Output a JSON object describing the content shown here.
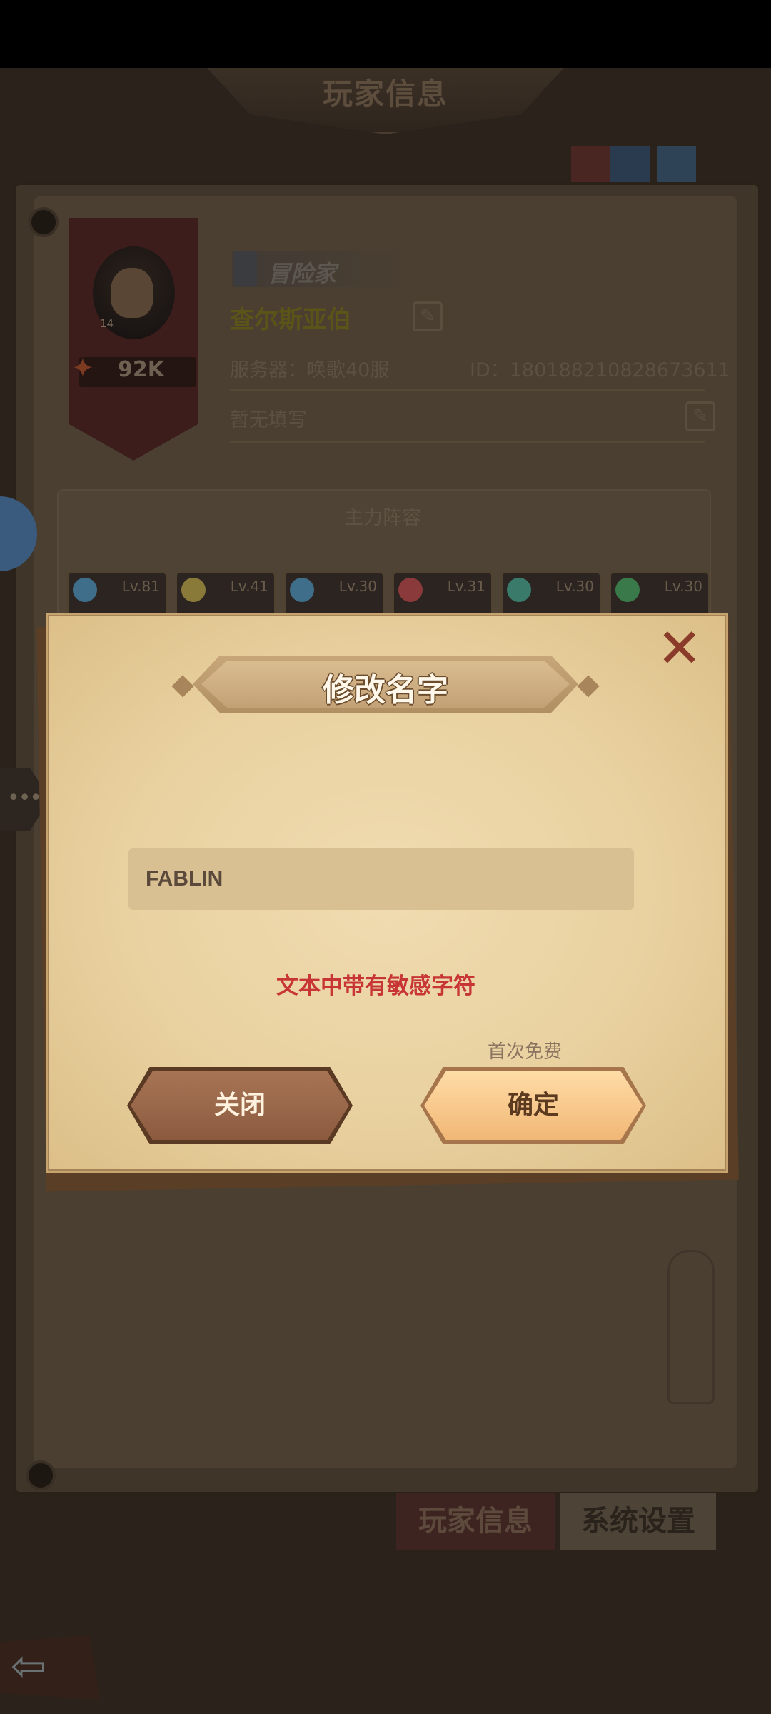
{
  "header": {
    "title": "玩家信息"
  },
  "profile": {
    "rank_label": "冒险家",
    "level": "14",
    "power": "92K",
    "name": "查尔斯亚伯",
    "server": "服务器：唤歌40服",
    "id": "ID：180188210828673611",
    "signature": "暂无填写"
  },
  "lineup": {
    "title": "主力阵容",
    "heroes": [
      {
        "level": "Lv.81",
        "element_color": "#3f6e8a"
      },
      {
        "level": "Lv.41",
        "element_color": "#8a7a3a"
      },
      {
        "level": "Lv.30",
        "element_color": "#3f6e8a"
      },
      {
        "level": "Lv.31",
        "element_color": "#8a3a3a"
      },
      {
        "level": "Lv.30",
        "element_color": "#3a7a6a"
      },
      {
        "level": "Lv.30",
        "element_color": "#3a7a4a"
      }
    ]
  },
  "tabs": {
    "player_info": "玩家信息",
    "system_settings": "系统设置"
  },
  "dialog": {
    "title": "修改名字",
    "input_value": "FABLIN",
    "error_message": "文本中带有敏感字符",
    "free_note": "首次免费",
    "close_label": "关闭",
    "confirm_label": "确定"
  },
  "icons": {
    "close": "✕",
    "edit": "✎",
    "back": "⇦",
    "chat": "•••",
    "power": "✦"
  },
  "colors": {
    "error": "#c73534",
    "name_gold": "#5b5419",
    "dialog_bg": "#e9d1a0"
  }
}
